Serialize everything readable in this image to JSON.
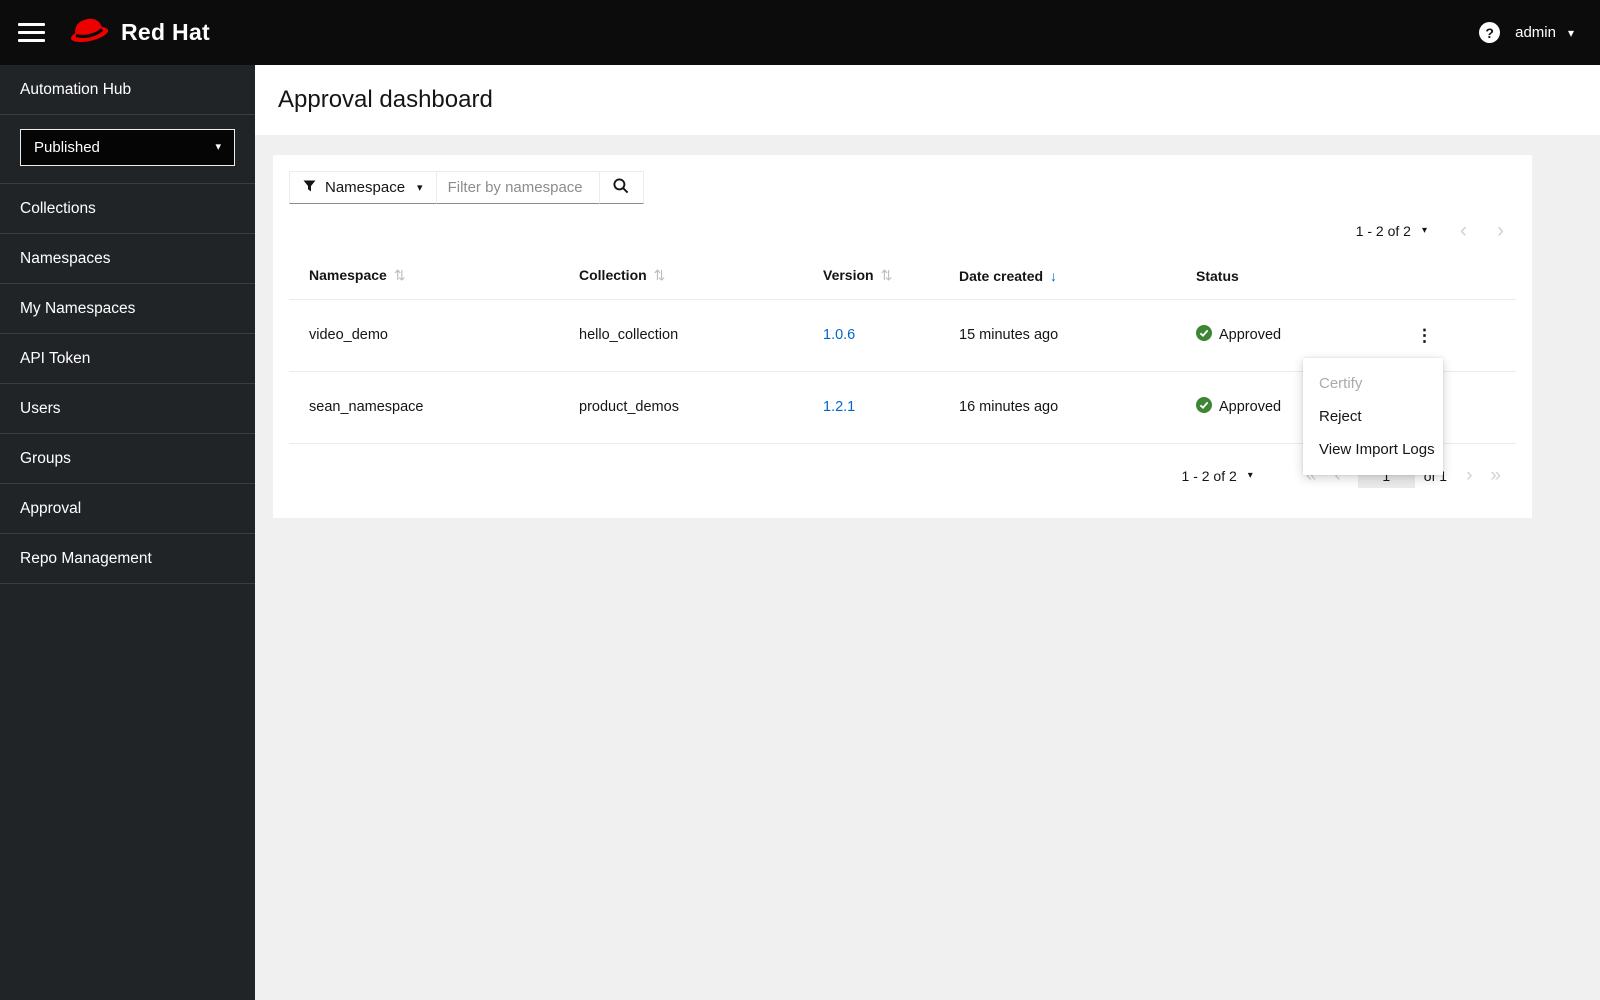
{
  "masthead": {
    "brand_label": "Red Hat",
    "help_glyph": "?",
    "username": "admin"
  },
  "icons": {
    "caret_down": "▾",
    "sort_both": "⇅",
    "sort_desc": "↓",
    "kebab": "⋮",
    "angle_left": "‹",
    "angle_right": "›",
    "angle_double_left": "«",
    "angle_double_right": "»"
  },
  "sidebar": {
    "repo_select": {
      "value": "Published"
    },
    "items": [
      {
        "label": "Automation Hub"
      },
      {
        "label": "Collections"
      },
      {
        "label": "Namespaces"
      },
      {
        "label": "My Namespaces"
      },
      {
        "label": "API Token"
      },
      {
        "label": "Users"
      },
      {
        "label": "Groups"
      },
      {
        "label": "Approval"
      },
      {
        "label": "Repo Management"
      }
    ]
  },
  "page": {
    "title": "Approval dashboard"
  },
  "toolbar": {
    "filter_label": "Namespace",
    "filter_placeholder": "Filter by namespace"
  },
  "pagination_top": {
    "range": "1 - 2 of 2"
  },
  "table": {
    "headers": [
      {
        "label": "Namespace"
      },
      {
        "label": "Collection"
      },
      {
        "label": "Version"
      },
      {
        "label": "Date created"
      },
      {
        "label": "Status"
      }
    ],
    "rows": [
      {
        "namespace": "video_demo",
        "collection": "hello_collection",
        "version": "1.0.6",
        "date_created": "15 minutes ago",
        "status": "Approved"
      },
      {
        "namespace": "sean_namespace",
        "collection": "product_demos",
        "version": "1.2.1",
        "date_created": "16 minutes ago",
        "status": "Approved"
      }
    ]
  },
  "row_menu": {
    "items": [
      {
        "label": "Certify",
        "disabled": true
      },
      {
        "label": "Reject",
        "disabled": false
      },
      {
        "label": "View Import Logs",
        "disabled": false
      }
    ]
  },
  "pagination_bottom": {
    "range": "1 - 2 of 2",
    "current_page": "1",
    "of_label": "of 1"
  },
  "colors": {
    "brand_red": "#ee0000",
    "link": "#0066cc",
    "success_green": "#3e8635",
    "masthead_bg": "#0c0c0c",
    "sidebar_bg": "#212427"
  }
}
